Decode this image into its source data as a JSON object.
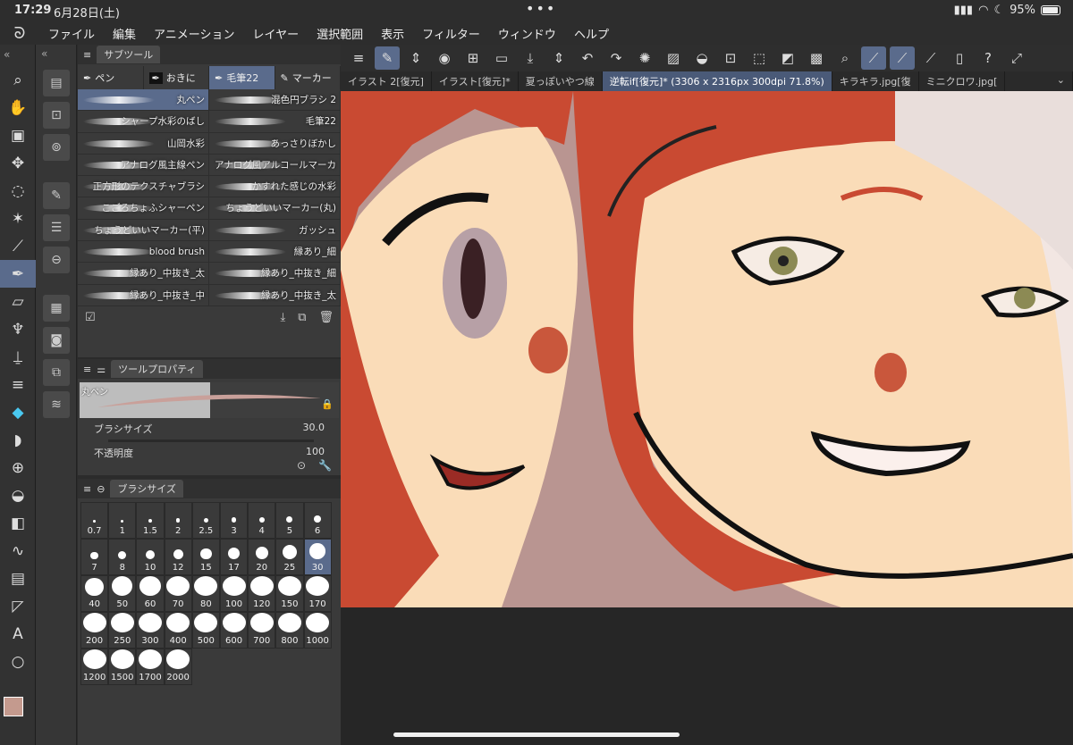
{
  "status": {
    "time": "17:29",
    "date": "6月28日(土)",
    "dots": "•••",
    "battery": "95%"
  },
  "menu": [
    "ファイル",
    "編集",
    "アニメーション",
    "レイヤー",
    "選択範囲",
    "表示",
    "フィルター",
    "ウィンドウ",
    "ヘルプ"
  ],
  "subtool": {
    "title": "サブツール",
    "groups": [
      "ペン",
      "おきに",
      "毛筆22",
      "マーカー"
    ],
    "brushes": [
      "丸ペン",
      "混色円ブラシ 2",
      "シャープ水彩のばし",
      "毛筆22",
      "山岡水彩",
      "あっさりぼかし",
      "アナログ風主線ペン",
      "アナログ風アルコールマーカー",
      "正方形のテクスチャブラシ",
      "かすれた感じの水彩",
      "こごろちょふシャーペン",
      "ちょうどいいマーカー(丸)",
      "ちょうどいいマーカー(平)",
      "ガッシュ",
      "blood brush",
      "縁あり_細",
      "縁あり_中抜き_太",
      "縁あり_中抜き_細",
      "縁あり_中抜き_中",
      "縁あり_中抜き_太"
    ]
  },
  "toolprop": {
    "title": "ツールプロパティ",
    "name": "丸ペン",
    "brush_size_label": "ブラシサイズ",
    "brush_size_value": "30.0",
    "opacity_label": "不透明度",
    "opacity_value": "100"
  },
  "brushsize": {
    "title": "ブラシサイズ",
    "sizes": [
      "0.7",
      "1",
      "1.5",
      "2",
      "2.5",
      "3",
      "4",
      "5",
      "6",
      "7",
      "8",
      "10",
      "12",
      "15",
      "17",
      "20",
      "25",
      "30",
      "40",
      "50",
      "60",
      "70",
      "80",
      "100",
      "120",
      "150",
      "170",
      "200",
      "250",
      "300",
      "400",
      "500",
      "600",
      "700",
      "800",
      "1000",
      "1200",
      "1500",
      "1700",
      "2000"
    ],
    "selected": "30"
  },
  "tabs": [
    "イラスト 2[復元]",
    "イラスト[復元]*",
    "夏っぽいやつ線",
    "逆転if[復元]* (3306 x 2316px 300dpi 71.8%)",
    "キラキラ.jpg[復",
    "ミニクロワ.jpg["
  ],
  "colors": {
    "main": "#c49a8e",
    "sub": "#d8b8a8"
  }
}
